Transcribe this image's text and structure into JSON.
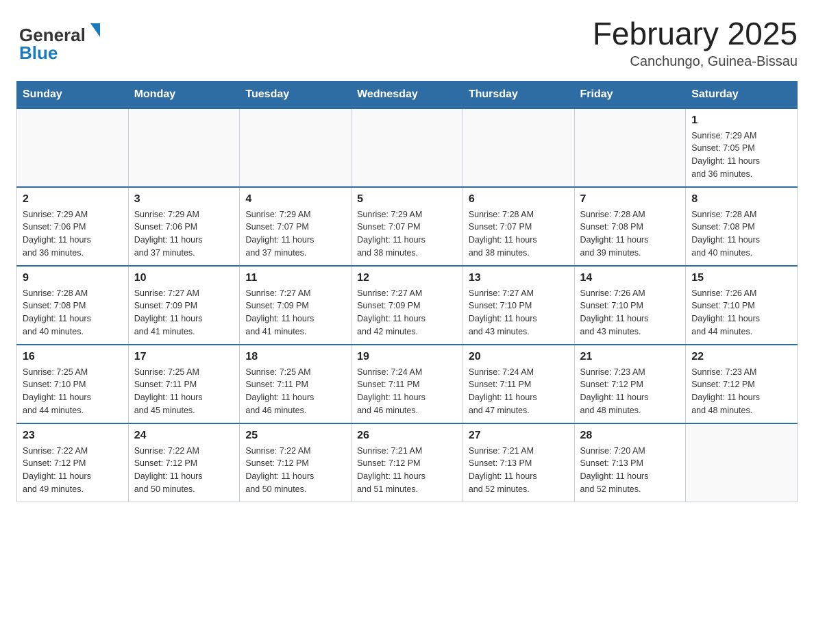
{
  "header": {
    "logo_general": "General",
    "logo_blue": "Blue",
    "title": "February 2025",
    "subtitle": "Canchungo, Guinea-Bissau"
  },
  "days_of_week": [
    "Sunday",
    "Monday",
    "Tuesday",
    "Wednesday",
    "Thursday",
    "Friday",
    "Saturday"
  ],
  "weeks": [
    {
      "days": [
        {
          "number": "",
          "info": ""
        },
        {
          "number": "",
          "info": ""
        },
        {
          "number": "",
          "info": ""
        },
        {
          "number": "",
          "info": ""
        },
        {
          "number": "",
          "info": ""
        },
        {
          "number": "",
          "info": ""
        },
        {
          "number": "1",
          "info": "Sunrise: 7:29 AM\nSunset: 7:05 PM\nDaylight: 11 hours\nand 36 minutes."
        }
      ]
    },
    {
      "days": [
        {
          "number": "2",
          "info": "Sunrise: 7:29 AM\nSunset: 7:06 PM\nDaylight: 11 hours\nand 36 minutes."
        },
        {
          "number": "3",
          "info": "Sunrise: 7:29 AM\nSunset: 7:06 PM\nDaylight: 11 hours\nand 37 minutes."
        },
        {
          "number": "4",
          "info": "Sunrise: 7:29 AM\nSunset: 7:07 PM\nDaylight: 11 hours\nand 37 minutes."
        },
        {
          "number": "5",
          "info": "Sunrise: 7:29 AM\nSunset: 7:07 PM\nDaylight: 11 hours\nand 38 minutes."
        },
        {
          "number": "6",
          "info": "Sunrise: 7:28 AM\nSunset: 7:07 PM\nDaylight: 11 hours\nand 38 minutes."
        },
        {
          "number": "7",
          "info": "Sunrise: 7:28 AM\nSunset: 7:08 PM\nDaylight: 11 hours\nand 39 minutes."
        },
        {
          "number": "8",
          "info": "Sunrise: 7:28 AM\nSunset: 7:08 PM\nDaylight: 11 hours\nand 40 minutes."
        }
      ]
    },
    {
      "days": [
        {
          "number": "9",
          "info": "Sunrise: 7:28 AM\nSunset: 7:08 PM\nDaylight: 11 hours\nand 40 minutes."
        },
        {
          "number": "10",
          "info": "Sunrise: 7:27 AM\nSunset: 7:09 PM\nDaylight: 11 hours\nand 41 minutes."
        },
        {
          "number": "11",
          "info": "Sunrise: 7:27 AM\nSunset: 7:09 PM\nDaylight: 11 hours\nand 41 minutes."
        },
        {
          "number": "12",
          "info": "Sunrise: 7:27 AM\nSunset: 7:09 PM\nDaylight: 11 hours\nand 42 minutes."
        },
        {
          "number": "13",
          "info": "Sunrise: 7:27 AM\nSunset: 7:10 PM\nDaylight: 11 hours\nand 43 minutes."
        },
        {
          "number": "14",
          "info": "Sunrise: 7:26 AM\nSunset: 7:10 PM\nDaylight: 11 hours\nand 43 minutes."
        },
        {
          "number": "15",
          "info": "Sunrise: 7:26 AM\nSunset: 7:10 PM\nDaylight: 11 hours\nand 44 minutes."
        }
      ]
    },
    {
      "days": [
        {
          "number": "16",
          "info": "Sunrise: 7:25 AM\nSunset: 7:10 PM\nDaylight: 11 hours\nand 44 minutes."
        },
        {
          "number": "17",
          "info": "Sunrise: 7:25 AM\nSunset: 7:11 PM\nDaylight: 11 hours\nand 45 minutes."
        },
        {
          "number": "18",
          "info": "Sunrise: 7:25 AM\nSunset: 7:11 PM\nDaylight: 11 hours\nand 46 minutes."
        },
        {
          "number": "19",
          "info": "Sunrise: 7:24 AM\nSunset: 7:11 PM\nDaylight: 11 hours\nand 46 minutes."
        },
        {
          "number": "20",
          "info": "Sunrise: 7:24 AM\nSunset: 7:11 PM\nDaylight: 11 hours\nand 47 minutes."
        },
        {
          "number": "21",
          "info": "Sunrise: 7:23 AM\nSunset: 7:12 PM\nDaylight: 11 hours\nand 48 minutes."
        },
        {
          "number": "22",
          "info": "Sunrise: 7:23 AM\nSunset: 7:12 PM\nDaylight: 11 hours\nand 48 minutes."
        }
      ]
    },
    {
      "days": [
        {
          "number": "23",
          "info": "Sunrise: 7:22 AM\nSunset: 7:12 PM\nDaylight: 11 hours\nand 49 minutes."
        },
        {
          "number": "24",
          "info": "Sunrise: 7:22 AM\nSunset: 7:12 PM\nDaylight: 11 hours\nand 50 minutes."
        },
        {
          "number": "25",
          "info": "Sunrise: 7:22 AM\nSunset: 7:12 PM\nDaylight: 11 hours\nand 50 minutes."
        },
        {
          "number": "26",
          "info": "Sunrise: 7:21 AM\nSunset: 7:12 PM\nDaylight: 11 hours\nand 51 minutes."
        },
        {
          "number": "27",
          "info": "Sunrise: 7:21 AM\nSunset: 7:13 PM\nDaylight: 11 hours\nand 52 minutes."
        },
        {
          "number": "28",
          "info": "Sunrise: 7:20 AM\nSunset: 7:13 PM\nDaylight: 11 hours\nand 52 minutes."
        },
        {
          "number": "",
          "info": ""
        }
      ]
    }
  ]
}
